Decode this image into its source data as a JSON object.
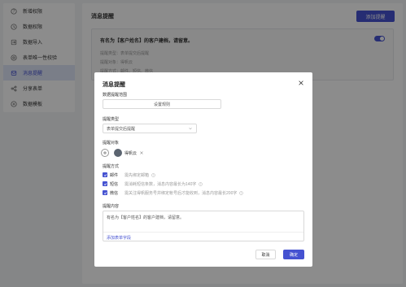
{
  "sidebar": {
    "items": [
      {
        "label": "新增权限",
        "icon": "question-circle-icon",
        "active": false
      },
      {
        "label": "数据权限",
        "icon": "shield-icon",
        "active": false
      },
      {
        "label": "数据导入",
        "icon": "import-icon",
        "active": false
      },
      {
        "label": "表单唯一性校验",
        "icon": "check-circle-icon",
        "active": false
      },
      {
        "label": "消息提醒",
        "icon": "bell-icon",
        "active": true
      },
      {
        "label": "分享表单",
        "icon": "share-icon",
        "active": false
      },
      {
        "label": "数据模板",
        "icon": "template-icon",
        "active": false
      }
    ]
  },
  "main": {
    "title": "消息提醒",
    "add_button": "添加提醒",
    "rule": {
      "title": "有名为【客户姓名】的客户建档，请留意。",
      "line1": "提醒类型：表单提交后提醒",
      "line2": "提醒对象：得帆云",
      "line3": "提醒方式：邮件、短信、微信",
      "enabled": true
    }
  },
  "modal": {
    "title": "消息提醒",
    "range_label": "数据提醒范围",
    "range_value": "设置规则",
    "type_label": "提醒类型",
    "type_value": "表单提交后提醒",
    "target_label": "提醒对象",
    "target_chip": "得帆云",
    "method_label": "提醒方式",
    "methods": [
      {
        "name": "邮件",
        "desc": "需先绑定邮箱",
        "checked": true
      },
      {
        "name": "短信",
        "desc": "需消耗短信条数，消息内容最长为140字",
        "checked": true
      },
      {
        "name": "微信",
        "desc": "需关注得帆服务号并绑定帐号后才能收到，消息内容最长200字",
        "checked": true
      }
    ],
    "content_label": "提醒内容",
    "content_text": "有名为【客户姓名】的客户建档，请留意。",
    "insert_field": "添加表单字段",
    "cancel_label": "取消",
    "confirm_label": "确定"
  },
  "colors": {
    "accent": "#4552d1",
    "active_bg": "#dfe5f7"
  }
}
